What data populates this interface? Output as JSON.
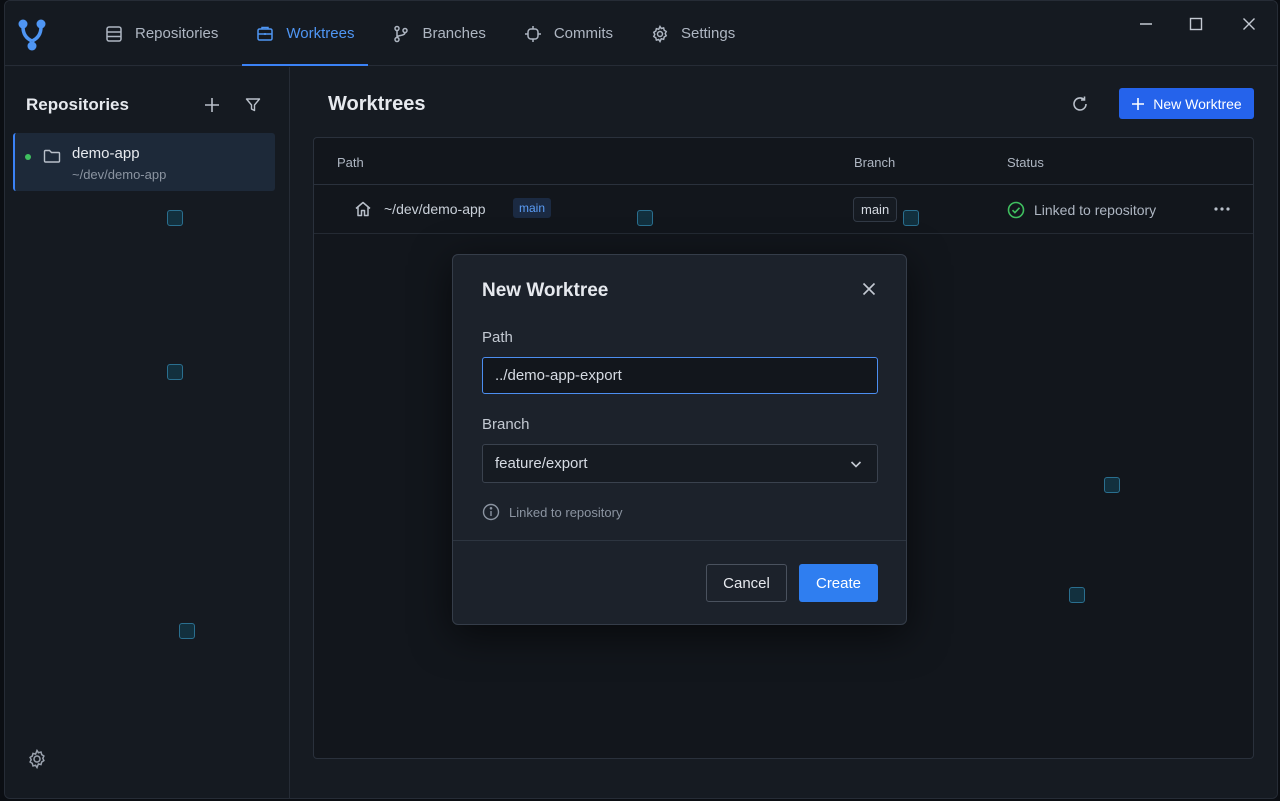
{
  "app": {
    "nav_tabs": [
      {
        "label": "Repositories",
        "icon": "database-icon"
      },
      {
        "label": "Worktrees",
        "icon": "worktree-icon"
      },
      {
        "label": "Branches",
        "icon": "git-branch-icon"
      },
      {
        "label": "Commits",
        "icon": "git-commit-icon"
      },
      {
        "label": "Settings",
        "icon": "gear-icon"
      }
    ],
    "active_tab": "Worktrees",
    "accent_color": "#3b82f6"
  },
  "sidebar": {
    "title": "Repositories",
    "repos": [
      {
        "name": "demo-app",
        "path": "~/dev/demo-app",
        "status_color": "#3fbf5f"
      }
    ]
  },
  "main": {
    "title": "Worktrees",
    "new_button_label": "New Worktree",
    "table": {
      "columns": [
        "Path",
        "Branch",
        "Status"
      ],
      "rows": [
        {
          "path": "~/dev/demo-app",
          "path_badge": "main",
          "branch": "main",
          "status": "Linked to repository"
        }
      ]
    }
  },
  "dialog": {
    "title": "New Worktree",
    "path_label": "Path",
    "path_value": "../demo-app-export",
    "branch_label": "Branch",
    "branch_value": "feature/export",
    "info_text": "Linked to repository",
    "cancel_label": "Cancel",
    "create_label": "Create"
  }
}
